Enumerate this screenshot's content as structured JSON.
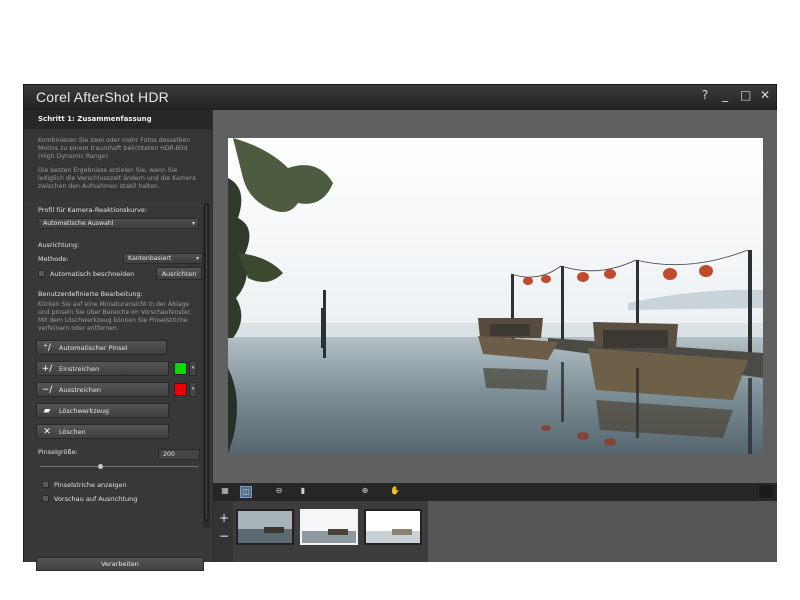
{
  "window": {
    "title": "Corel AfterShot HDR",
    "controls": [
      "?",
      "_",
      "□",
      "✕"
    ]
  },
  "left_panel": {
    "step_header": "Schritt 1: Zusammenfassung",
    "description": [
      "Kombinieren Sie zwei oder mehr Fotos desselben Motivs zu einem traumhaft belichteten HDR-Bild (High Dynamic Range).",
      "Die besten Ergebnisse erzielen Sie, wenn Sie lediglich die Verschlusszeit ändern und die Kamera zwischen den Aufnahmen stabil halten."
    ],
    "camera_profile_label": "Profil für Kamera-Reaktionskurve:",
    "camera_profile_value": "Automatische Auswahl",
    "alignment_label": "Ausrichtung:",
    "method_label": "Methode:",
    "method_value": "Kantenbasiert",
    "auto_crop_label": "Automatisch beschneiden",
    "align_button": "Ausrichten",
    "custom_edit_label": "Benutzerdefinierte Bearbeitung:",
    "custom_edit_help": "Klicken Sie auf eine Miniaturansicht in der Ablage und pinseln Sie über Bereiche im Vorschaufenster. Mit dem Löschwerkzeug können Sie Pinselstriche verfeinern oder entfernen.",
    "auto_brush_button": "Automatischer Pinsel",
    "brush_in_button": "Einstreichen",
    "brush_out_button": "Ausstreichen",
    "eraser_button": "Löschwerkzeug",
    "delete_button": "Löschen",
    "brush_size_label": "Pinselgröße:",
    "brush_size_value": "200",
    "brush_size_fraction": 0.38,
    "show_strokes_label": "Pinselstriche anzeigen",
    "preview_alignment_label": "Vorschau auf Ausrichtung",
    "process_button": "Verarbeiten"
  },
  "colors": {
    "brush_in": "#00dd00",
    "brush_out": "#ee0000",
    "active_tool": "#4c6a8a"
  },
  "toolbar": {
    "icons": [
      "fit-view-icon",
      "compare-view-icon",
      "zoom-out-icon",
      "zoom-slider-icon",
      "zoom-in-icon",
      "pan-hand-icon"
    ]
  },
  "filmstrip": {
    "add": "+",
    "remove": "−",
    "thumbnails": 3,
    "selected_index": 1
  }
}
